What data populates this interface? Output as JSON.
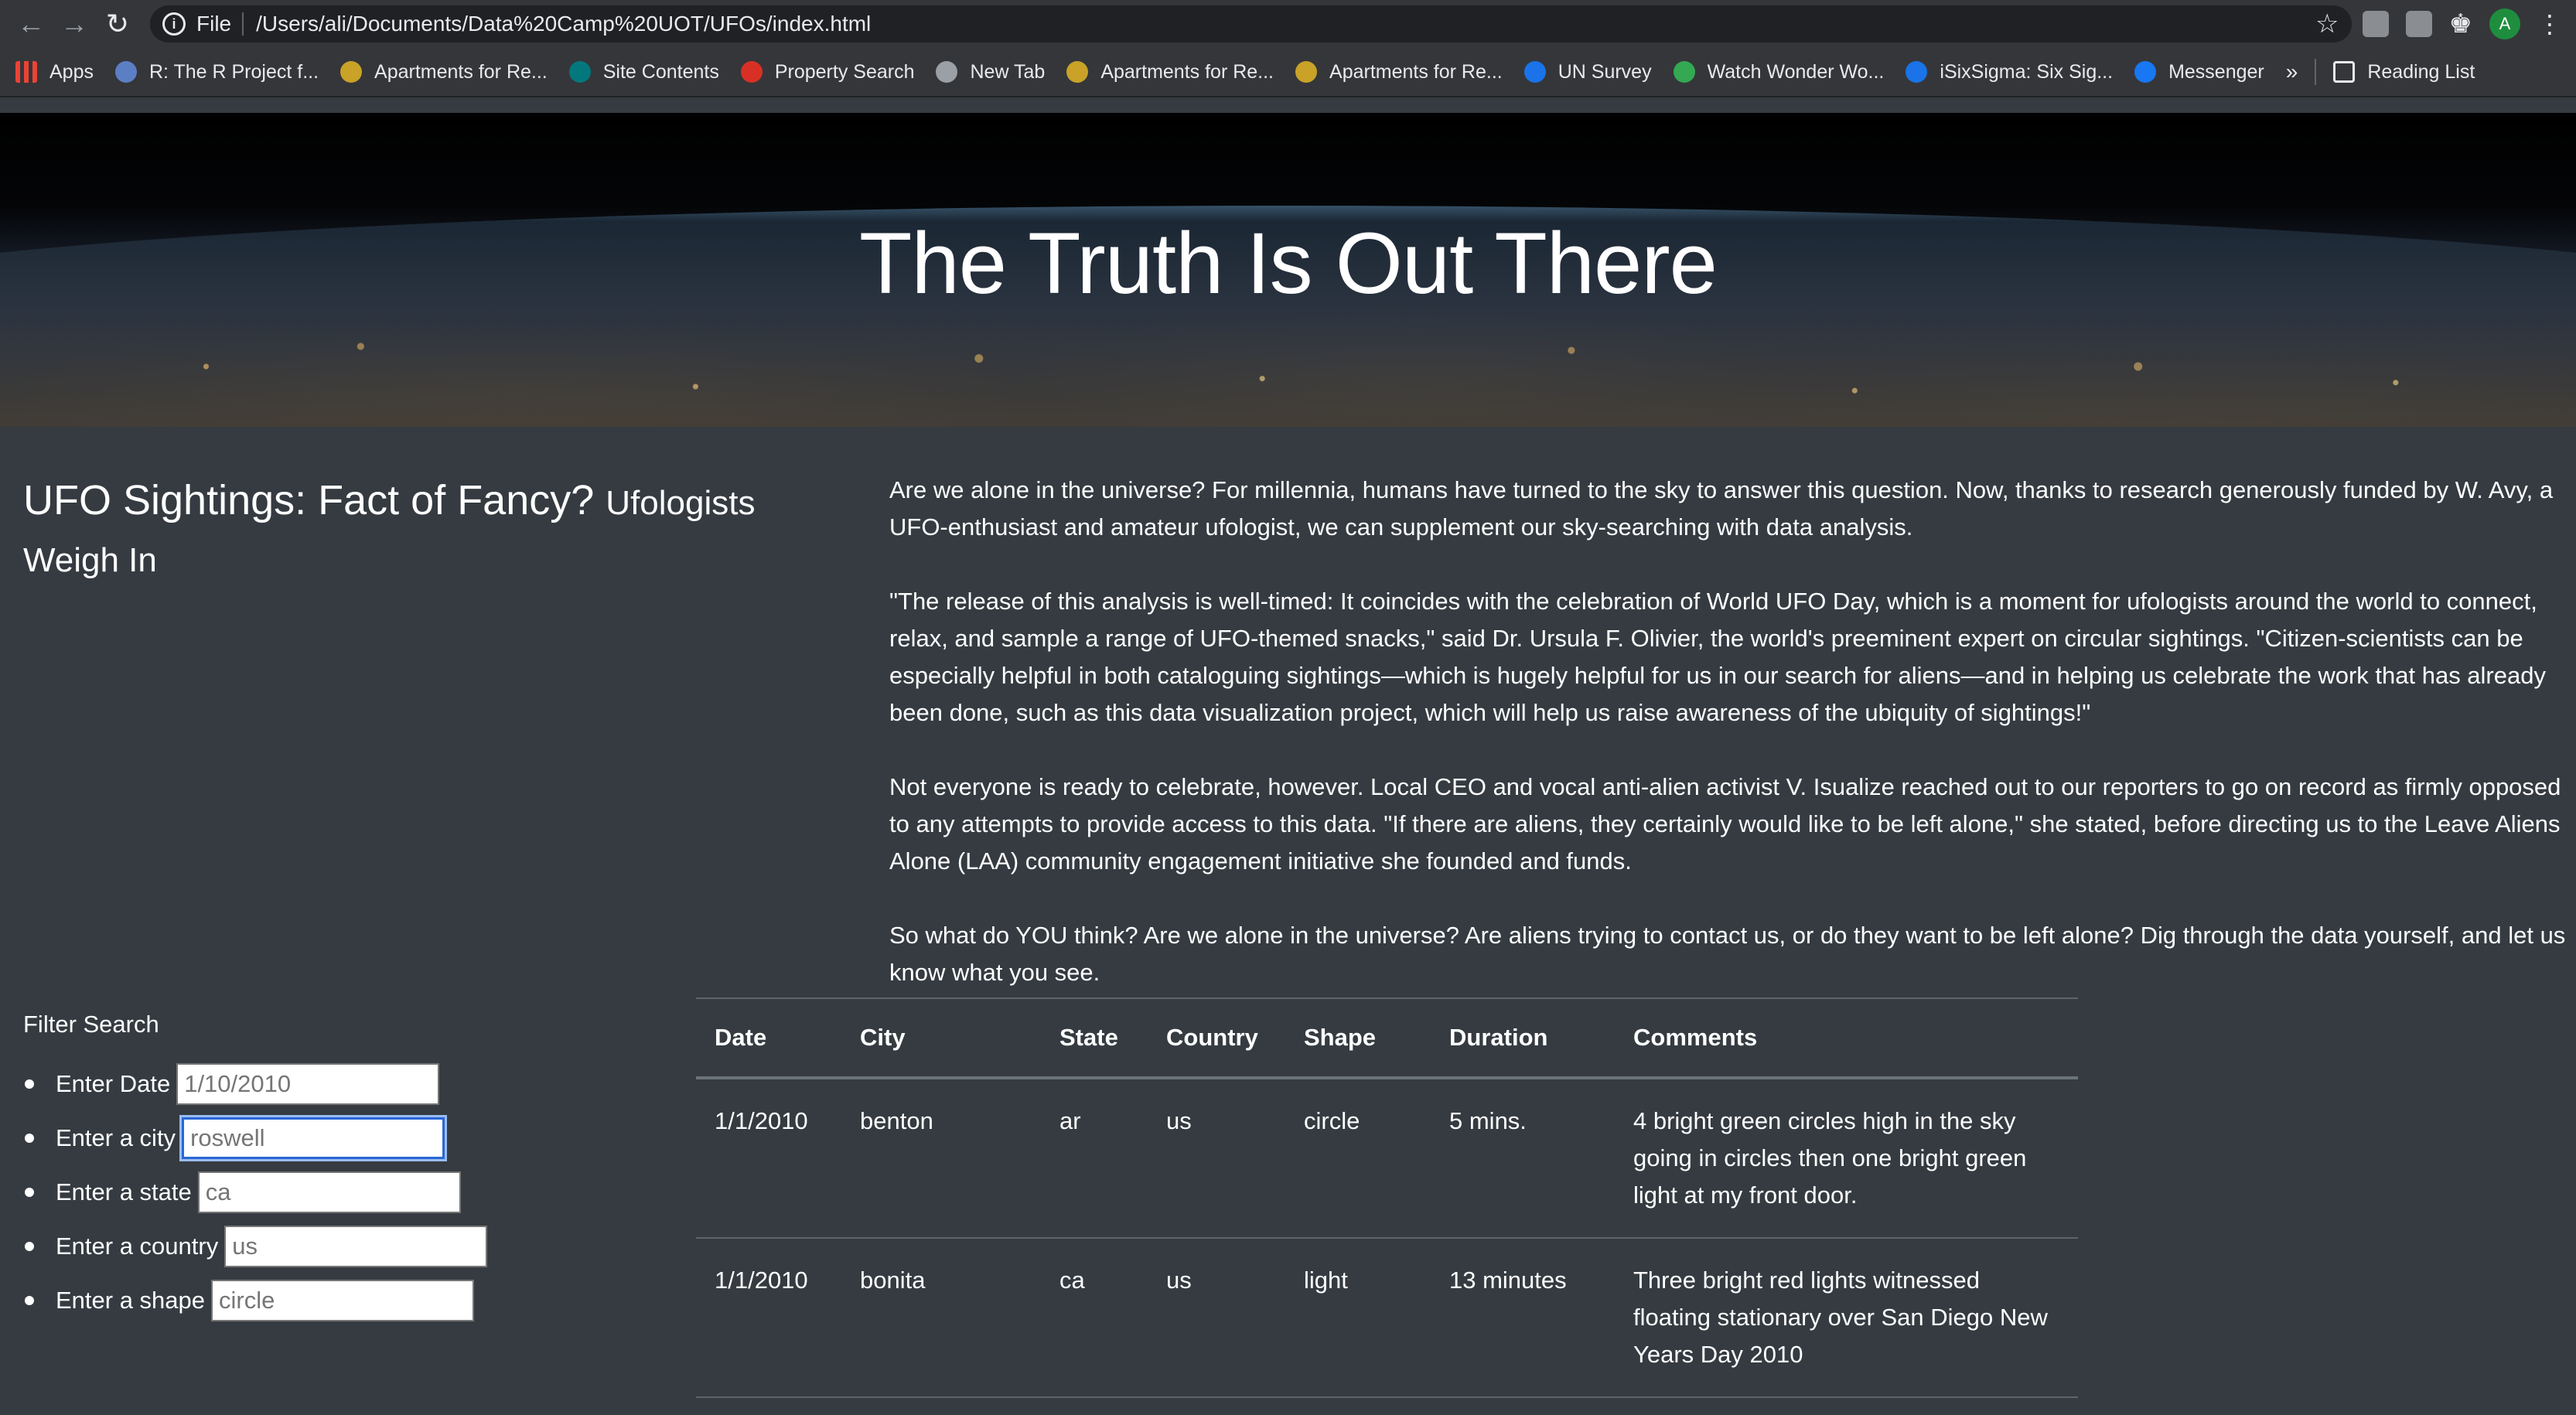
{
  "browser": {
    "omnibox_scheme": "File",
    "url": "/Users/ali/Documents/Data%20Camp%20UOT/UFOs/index.html",
    "avatar_letter": "A",
    "bookmarks": [
      {
        "label": "Apps",
        "icon": "apps-grid-icon",
        "color": "#ea4335"
      },
      {
        "label": "R: The R Project f...",
        "icon": "r-project-icon",
        "color": "#5c7fc4"
      },
      {
        "label": "Apartments for Re...",
        "icon": "apartments-icon",
        "color": "#c9a227"
      },
      {
        "label": "Site Contents",
        "icon": "sharepoint-icon",
        "color": "#03787c"
      },
      {
        "label": "Property Search",
        "icon": "property-icon",
        "color": "#d93025"
      },
      {
        "label": "New Tab",
        "icon": "globe-icon",
        "color": "#9aa0a6"
      },
      {
        "label": "Apartments for Re...",
        "icon": "apartments-icon",
        "color": "#c9a227"
      },
      {
        "label": "Apartments for Re...",
        "icon": "apartments-icon",
        "color": "#c9a227"
      },
      {
        "label": "UN Survey",
        "icon": "checkmark-icon",
        "color": "#1a73e8"
      },
      {
        "label": "Watch Wonder Wo...",
        "icon": "play-icon",
        "color": "#34a853"
      },
      {
        "label": "iSixSigma: Six Sig...",
        "icon": "info-icon",
        "color": "#1a73e8"
      },
      {
        "label": "Messenger",
        "icon": "facebook-icon",
        "color": "#1877f2"
      }
    ],
    "bookmarks_more": "»",
    "reading_list": "Reading List"
  },
  "hero": {
    "title": "The Truth Is Out There"
  },
  "article": {
    "title": "UFO Sightings: Fact of Fancy?",
    "subtitle": "Ufologists Weigh In",
    "paragraphs": [
      "Are we alone in the universe? For millennia, humans have turned to the sky to answer this question. Now, thanks to research generously funded by W. Avy, a UFO-enthusiast and amateur ufologist, we can supplement our sky-searching with data analysis.",
      "\"The release of this analysis is well-timed: It coincides with the celebration of World UFO Day, which is a moment for ufologists around the world to connect, relax, and sample a range of UFO-themed snacks,\" said Dr. Ursula F. Olivier, the world's preeminent expert on circular sightings. \"Citizen-scientists can be especially helpful in both cataloguing sightings—which is hugely helpful for us in our search for aliens—and in helping us celebrate the work that has already been done, such as this data visualization project, which will help us raise awareness of the ubiquity of sightings!\"",
      "Not everyone is ready to celebrate, however. Local CEO and vocal anti-alien activist V. Isualize reached out to our reporters to go on record as firmly opposed to any attempts to provide access to this data. \"If there are aliens, they certainly would like to be left alone,\" she stated, before directing us to the Leave Aliens Alone (LAA) community engagement initiative she founded and funds.",
      "So what do YOU think? Are we alone in the universe? Are aliens trying to contact us, or do they want to be left alone? Dig through the data yourself, and let us know what you see."
    ]
  },
  "filters": {
    "title": "Filter Search",
    "items": [
      {
        "label": "Enter Date",
        "placeholder": "1/10/2010"
      },
      {
        "label": "Enter a city",
        "placeholder": "roswell"
      },
      {
        "label": "Enter a state",
        "placeholder": "ca"
      },
      {
        "label": "Enter a country",
        "placeholder": "us"
      },
      {
        "label": "Enter a shape",
        "placeholder": "circle"
      }
    ]
  },
  "table": {
    "headers": [
      "Date",
      "City",
      "State",
      "Country",
      "Shape",
      "Duration",
      "Comments"
    ],
    "rows": [
      [
        "1/1/2010",
        "benton",
        "ar",
        "us",
        "circle",
        "5 mins.",
        "4 bright green circles high in the sky going in circles then one bright green light at my front door."
      ],
      [
        "1/1/2010",
        "bonita",
        "ca",
        "us",
        "light",
        "13 minutes",
        "Three bright red lights witnessed floating stationary over San Diego New Years Day 2010"
      ]
    ]
  }
}
